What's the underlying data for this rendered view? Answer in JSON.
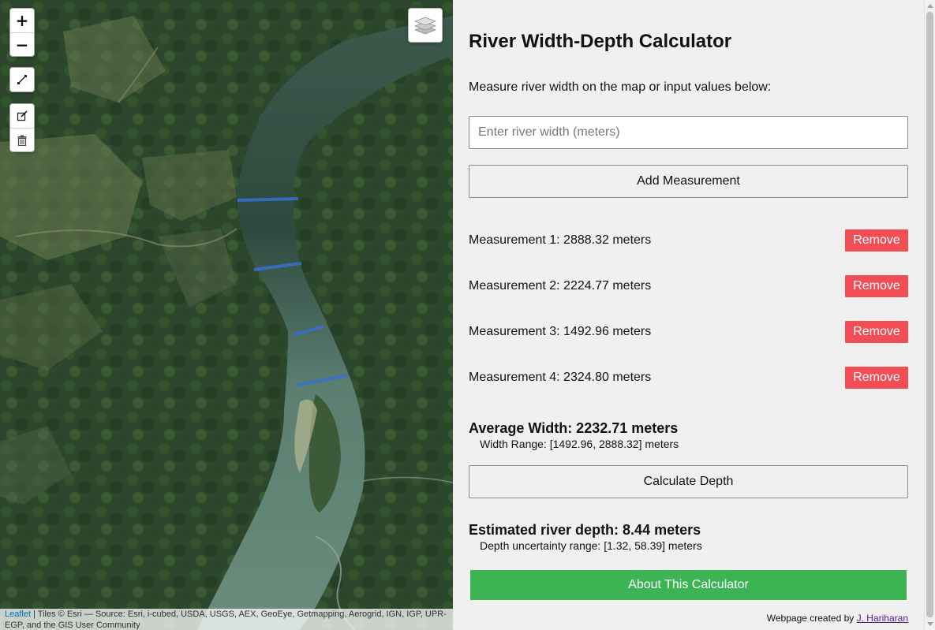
{
  "map": {
    "zoom_in": "+",
    "zoom_out": "−",
    "attribution": {
      "link": "Leaflet",
      "text": " | Tiles © Esri — Source: Esri, i-cubed, USDA, USGS, AEX, GeoEye, Getmapping, Aerogrid, IGN, IGP, UPR-EGP, and the GIS User Community"
    },
    "icons": [
      "zoom-in-icon",
      "zoom-out-icon",
      "measure-line-icon",
      "edit-icon",
      "trash-icon",
      "layers-icon"
    ],
    "measure_line_color": "#3a6fd0"
  },
  "panel": {
    "title": "River Width-Depth Calculator",
    "intro": "Measure river width on the map or input values below:",
    "width_placeholder": "Enter river width (meters)",
    "add_button": "Add Measurement",
    "measurements": [
      {
        "label": "Measurement 1: 2888.32 meters",
        "remove": "Remove"
      },
      {
        "label": "Measurement 2: 2224.77 meters",
        "remove": "Remove"
      },
      {
        "label": "Measurement 3: 1492.96 meters",
        "remove": "Remove"
      },
      {
        "label": "Measurement 4: 2324.80 meters",
        "remove": "Remove"
      }
    ],
    "average_width": "Average Width: 2232.71 meters",
    "width_range": "Width Range: [1492.96, 2888.32] meters",
    "calculate_button": "Calculate Depth",
    "depth_result": "Estimated river depth: 8.44 meters",
    "depth_range": "Depth uncertainty range: [1.32, 58.39] meters",
    "about_button": "About This Calculator",
    "credit_prefix": "Webpage created by ",
    "credit_link": "J. Hariharan",
    "colors": {
      "remove_button": "#f24d55",
      "about_button": "#3cb454",
      "panel_background": "#f0f0f0"
    }
  }
}
